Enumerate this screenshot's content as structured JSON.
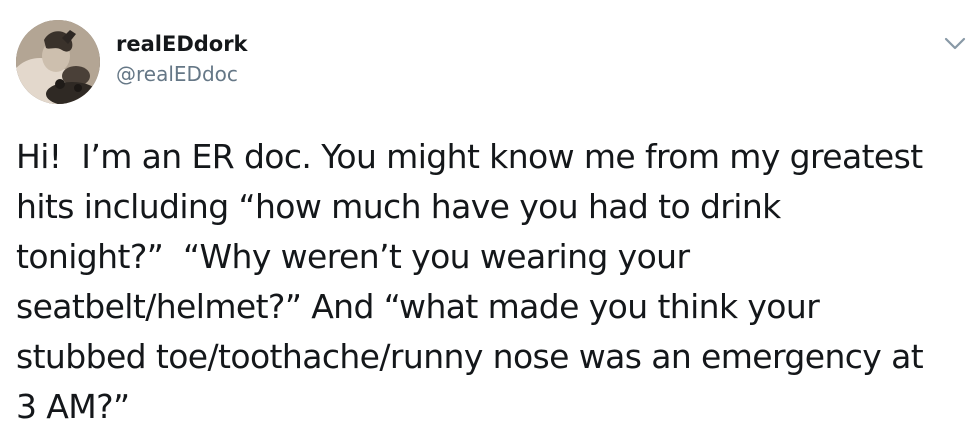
{
  "user": {
    "display_name": "realEDdork",
    "handle": "@realEDdoc"
  },
  "icons": {
    "avatar": "profile-photo",
    "menu": "chevron-down-icon"
  },
  "tweet": {
    "text": "Hi!  I’m an ER doc. You might know me from my greatest\nhits including “how much have you had to drink\ntonight?”  “Why weren’t you wearing your\nseatbelt/helmet?” And “what made you think your\nstubbed toe/toothache/runny nose was an emergency at\n3 AM?”"
  },
  "colors": {
    "text": "#14171a",
    "secondary": "#657786",
    "caret": "#8899a6"
  }
}
